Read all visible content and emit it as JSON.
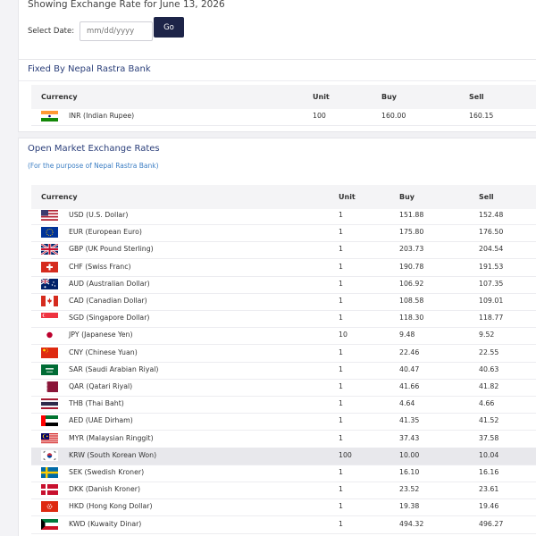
{
  "header": {
    "title": "Showing Exchange Rate for June 13, 2026",
    "date_label": "Select Date:",
    "date_placeholder": "mm/dd/yyyy",
    "go_label": "Go"
  },
  "fixed": {
    "title": "Fixed By Nepal Rastra Bank",
    "columns": [
      "Currency",
      "Unit",
      "Buy",
      "Sell"
    ],
    "rows": [
      {
        "flag": "in-flag-icon",
        "currency": "INR (Indian Rupee)",
        "unit": "100",
        "buy": "160.00",
        "sell": "160.15"
      }
    ]
  },
  "open": {
    "title": "Open Market Exchange Rates",
    "subtitle": "(For the purpose of Nepal Rastra Bank)",
    "columns": [
      "Currency",
      "Unit",
      "Buy",
      "Sell"
    ],
    "rows": [
      {
        "flag": "us-flag-icon",
        "currency": "USD (U.S. Dollar)",
        "unit": "1",
        "buy": "151.88",
        "sell": "152.48"
      },
      {
        "flag": "eu-flag-icon",
        "currency": "EUR (European Euro)",
        "unit": "1",
        "buy": "175.80",
        "sell": "176.50"
      },
      {
        "flag": "gb-flag-icon",
        "currency": "GBP (UK Pound Sterling)",
        "unit": "1",
        "buy": "203.73",
        "sell": "204.54"
      },
      {
        "flag": "ch-flag-icon",
        "currency": "CHF (Swiss Franc)",
        "unit": "1",
        "buy": "190.78",
        "sell": "191.53"
      },
      {
        "flag": "au-flag-icon",
        "currency": "AUD (Australian Dollar)",
        "unit": "1",
        "buy": "106.92",
        "sell": "107.35"
      },
      {
        "flag": "ca-flag-icon",
        "currency": "CAD (Canadian Dollar)",
        "unit": "1",
        "buy": "108.58",
        "sell": "109.01"
      },
      {
        "flag": "sg-flag-icon",
        "currency": "SGD (Singapore Dollar)",
        "unit": "1",
        "buy": "118.30",
        "sell": "118.77"
      },
      {
        "flag": "jp-flag-icon",
        "currency": "JPY (Japanese Yen)",
        "unit": "10",
        "buy": "9.48",
        "sell": "9.52"
      },
      {
        "flag": "cn-flag-icon",
        "currency": "CNY (Chinese Yuan)",
        "unit": "1",
        "buy": "22.46",
        "sell": "22.55"
      },
      {
        "flag": "sa-flag-icon",
        "currency": "SAR (Saudi Arabian Riyal)",
        "unit": "1",
        "buy": "40.47",
        "sell": "40.63"
      },
      {
        "flag": "qa-flag-icon",
        "currency": "QAR (Qatari Riyal)",
        "unit": "1",
        "buy": "41.66",
        "sell": "41.82"
      },
      {
        "flag": "th-flag-icon",
        "currency": "THB (Thai Baht)",
        "unit": "1",
        "buy": "4.64",
        "sell": "4.66"
      },
      {
        "flag": "ae-flag-icon",
        "currency": "AED (UAE Dirham)",
        "unit": "1",
        "buy": "41.35",
        "sell": "41.52"
      },
      {
        "flag": "my-flag-icon",
        "currency": "MYR (Malaysian Ringgit)",
        "unit": "1",
        "buy": "37.43",
        "sell": "37.58"
      },
      {
        "flag": "kr-flag-icon",
        "currency": "KRW (South Korean Won)",
        "unit": "100",
        "buy": "10.00",
        "sell": "10.04",
        "highlight": true
      },
      {
        "flag": "se-flag-icon",
        "currency": "SEK (Swedish Kroner)",
        "unit": "1",
        "buy": "16.10",
        "sell": "16.16"
      },
      {
        "flag": "dk-flag-icon",
        "currency": "DKK (Danish Kroner)",
        "unit": "1",
        "buy": "23.52",
        "sell": "23.61"
      },
      {
        "flag": "hk-flag-icon",
        "currency": "HKD (Hong Kong Dollar)",
        "unit": "1",
        "buy": "19.38",
        "sell": "19.46"
      },
      {
        "flag": "kw-flag-icon",
        "currency": "KWD (Kuwaity Dinar)",
        "unit": "1",
        "buy": "494.32",
        "sell": "496.27"
      }
    ]
  },
  "colors": {
    "go_button": "#1d2448",
    "section_title": "#2b3f7a",
    "subtitle": "#3d7fc4",
    "row_highlight": "#e8e8ec"
  }
}
